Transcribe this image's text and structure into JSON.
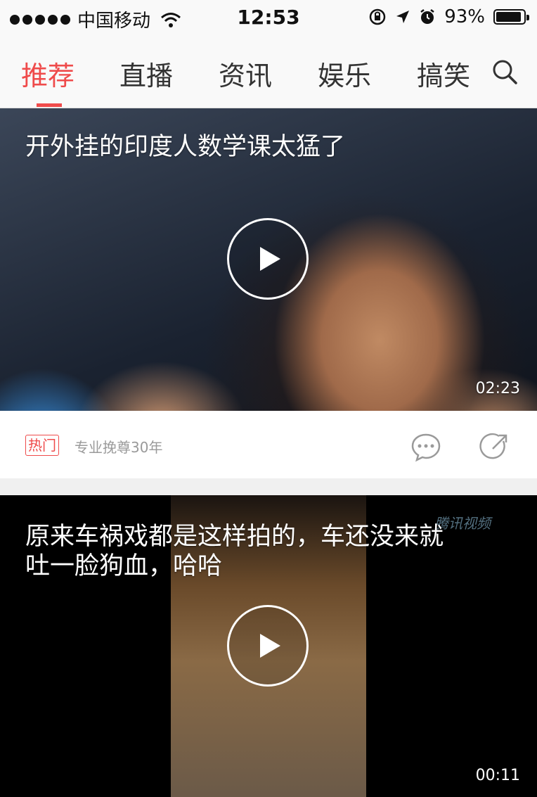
{
  "status_bar": {
    "carrier": "中国移动",
    "time": "12:53",
    "battery_percent": "93%",
    "battery_level": 0.93,
    "icons": [
      "signal-dots-icon",
      "wifi-icon",
      "rotation-lock-icon",
      "location-arrow-icon",
      "alarm-icon",
      "battery-icon"
    ]
  },
  "tabs": [
    {
      "label": "推荐",
      "active": true
    },
    {
      "label": "直播",
      "active": false
    },
    {
      "label": "资讯",
      "active": false
    },
    {
      "label": "娱乐",
      "active": false
    },
    {
      "label": "搞笑",
      "active": false
    }
  ],
  "colors": {
    "accent": "#ef4b4b",
    "meta_text": "#9a9a9a",
    "background": "#f2f2f2"
  },
  "feed": [
    {
      "title": "开外挂的印度人数学课太猛了",
      "duration": "02:23",
      "badge": "热门",
      "source": "专业挽尊30年",
      "icons": [
        "play-icon",
        "comment-icon",
        "share-icon"
      ]
    },
    {
      "title_line1": "原来车祸戏都是这样拍的，车还没来就",
      "title_line2": "吐一脸狗血，哈哈",
      "duration": "00:11",
      "watermark": "腾讯视频",
      "icons": [
        "play-icon"
      ]
    }
  ]
}
